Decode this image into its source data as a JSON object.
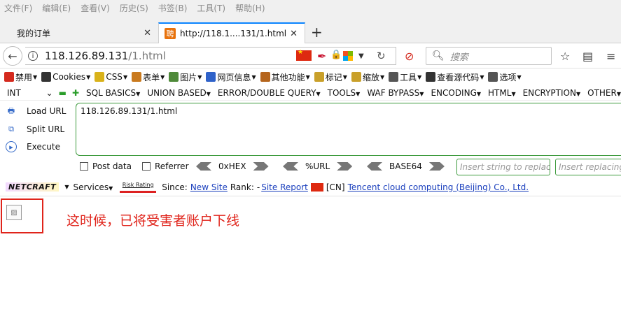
{
  "menubar": [
    "文件(F)",
    "编辑(E)",
    "查看(V)",
    "历史(S)",
    "书签(B)",
    "工具(T)",
    "帮助(H)"
  ],
  "tabs": [
    {
      "label": "我的订单",
      "active": false
    },
    {
      "label": "http://118.1....131/1.html",
      "active": true,
      "favicon": "聘"
    }
  ],
  "nav": {
    "url_host": "118.126.89.131",
    "url_path": "/1.html",
    "search_placeholder": "搜索"
  },
  "cn_toolbar": [
    {
      "label": "禁用",
      "icon": "no-entry-icon",
      "color": "#d42a1e"
    },
    {
      "label": "Cookies",
      "icon": "user-icon",
      "color": "#333333"
    },
    {
      "label": "CSS",
      "icon": "pencil-icon",
      "color": "#d9b21a"
    },
    {
      "label": "表单",
      "icon": "form-icon",
      "color": "#c97a1e"
    },
    {
      "label": "图片",
      "icon": "image-icon",
      "color": "#4f8a3a"
    },
    {
      "label": "网页信息",
      "icon": "info-icon",
      "color": "#2f62c9"
    },
    {
      "label": "其他功能",
      "icon": "box-icon",
      "color": "#b5651d"
    },
    {
      "label": "标记",
      "icon": "marker-icon",
      "color": "#c9a02a"
    },
    {
      "label": "缩放",
      "icon": "ruler-icon",
      "color": "#c9a02a"
    },
    {
      "label": "工具",
      "icon": "tools-icon",
      "color": "#555555"
    },
    {
      "label": "查看源代码",
      "icon": "terminal-icon",
      "color": "#333333"
    },
    {
      "label": "选项",
      "icon": "options-icon",
      "color": "#555555"
    }
  ],
  "hackbar": {
    "select_value": "INT",
    "menus": [
      "SQL BASICS",
      "UNION BASED",
      "ERROR/DOUBLE QUERY",
      "TOOLS",
      "WAF BYPASS",
      "ENCODING",
      "HTML",
      "ENCRYPTION",
      "OTHER"
    ],
    "actions": [
      "Load URL",
      "Split URL",
      "Execute"
    ],
    "textarea_value": "118.126.89.131/1.html",
    "checkboxes": [
      "Post data",
      "Referrer"
    ],
    "encoders": [
      "0xHEX",
      "%URL",
      "BASE64"
    ],
    "replace_placeholders": [
      "Insert string to replace",
      "Insert replacing string"
    ]
  },
  "netcraft": {
    "logo": "NETCRAFT",
    "services": "Services",
    "risk_label": "Risk Rating",
    "since_label": "Since:",
    "since_value": "New Site",
    "rank_label": "Rank:",
    "rank_value": "Site Report",
    "country": "[CN]",
    "host_org": "Tencent cloud computing (Beijing) Co., Ltd."
  },
  "content": {
    "caption": "这时候，已将受害者账户下线"
  }
}
